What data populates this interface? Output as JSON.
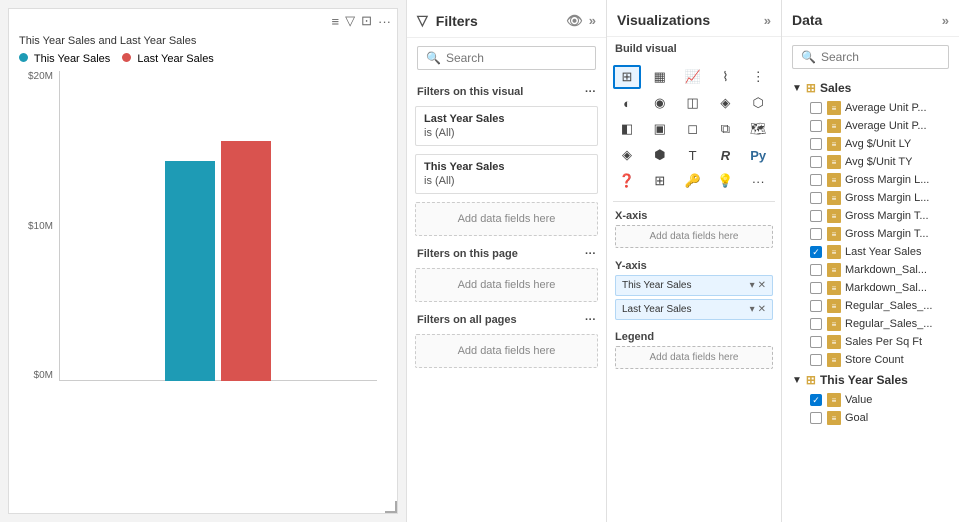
{
  "chart": {
    "title": "This Year Sales and Last Year Sales",
    "legend": [
      {
        "label": "This Year Sales",
        "color": "#1e9bb5"
      },
      {
        "label": "Last Year Sales",
        "color": "#d9534f"
      }
    ],
    "y_labels": [
      "$20M",
      "$10M",
      "$0M"
    ],
    "bar_blue_height": 220,
    "bar_red_height": 240,
    "toolbar_icons": [
      "≡",
      "▽",
      "⊡",
      "..."
    ]
  },
  "filters": {
    "panel_title": "Filters",
    "search_placeholder": "Search",
    "section_visual": "Filters on this visual",
    "section_page": "Filters on this page",
    "section_all": "Filters on all pages",
    "filter_items": [
      {
        "title": "Last Year Sales",
        "sub": "is (All)"
      },
      {
        "title": "This Year Sales",
        "sub": "is (All)"
      }
    ],
    "add_data_label": "Add data fields here"
  },
  "visualizations": {
    "panel_title": "Visualizations",
    "build_visual_label": "Build visual",
    "icons": [
      "▦",
      "▤",
      "▥",
      "▧",
      "▨",
      "▩",
      "△",
      "⌇",
      "⋮",
      "◫",
      "◈",
      "◉",
      "◐",
      "◑",
      "⬡",
      "⊞",
      "◧",
      "▣",
      "R",
      "🐍",
      "◻",
      "⧉",
      "◈",
      "⬢",
      "..."
    ],
    "x_axis_label": "X-axis",
    "x_axis_add": "Add data fields here",
    "y_axis_label": "Y-axis",
    "y_axis_fields": [
      {
        "name": "This Year Sales"
      },
      {
        "name": "Last Year Sales"
      }
    ],
    "legend_label": "Legend",
    "legend_add": "Add data fields here"
  },
  "data": {
    "panel_title": "Data",
    "search_placeholder": "Search",
    "groups": [
      {
        "name": "Sales",
        "items": [
          {
            "label": "Average Unit P...",
            "checked": false
          },
          {
            "label": "Average Unit P...",
            "checked": false
          },
          {
            "label": "Avg $/Unit LY",
            "checked": false
          },
          {
            "label": "Avg $/Unit TY",
            "checked": false
          },
          {
            "label": "Gross Margin L...",
            "checked": false
          },
          {
            "label": "Gross Margin L...",
            "checked": false
          },
          {
            "label": "Gross Margin T...",
            "checked": false
          },
          {
            "label": "Gross Margin T...",
            "checked": false
          },
          {
            "label": "Last Year Sales",
            "checked": true
          },
          {
            "label": "Markdown_Sal...",
            "checked": false
          },
          {
            "label": "Markdown_Sal...",
            "checked": false
          },
          {
            "label": "Regular_Sales_...",
            "checked": false
          },
          {
            "label": "Regular_Sales_...",
            "checked": false
          },
          {
            "label": "Sales Per Sq Ft",
            "checked": false
          },
          {
            "label": "Store Count",
            "checked": false
          }
        ]
      },
      {
        "name": "This Year Sales",
        "items": [
          {
            "label": "Value",
            "checked": true
          },
          {
            "label": "Goal",
            "checked": false
          }
        ]
      }
    ]
  }
}
